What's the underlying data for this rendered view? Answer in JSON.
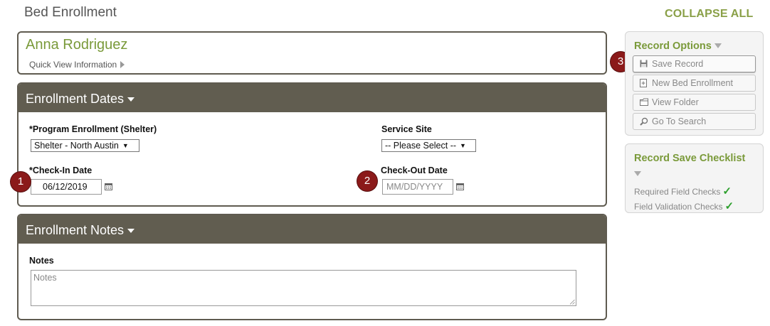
{
  "page": {
    "title": "Bed Enrollment",
    "collapse_all": "COLLAPSE ALL"
  },
  "client": {
    "name": "Anna Rodriguez",
    "quick_view": "Quick View Information"
  },
  "enrollment_dates": {
    "header": "Enrollment Dates",
    "program_label": "*Program Enrollment (Shelter)",
    "program_value": "Shelter - North Austin",
    "service_site_label": "Service Site",
    "service_site_value": "-- Please Select --",
    "checkin_label": "*Check-In Date",
    "checkin_value": "06/12/2019",
    "checkout_label": "Check-Out Date",
    "checkout_placeholder": "MM/DD/YYYY"
  },
  "enrollment_notes": {
    "header": "Enrollment Notes",
    "notes_label": "Notes",
    "notes_placeholder": "Notes"
  },
  "markers": [
    "1",
    "2",
    "3"
  ],
  "record_options": {
    "title": "Record Options",
    "buttons": [
      {
        "label": "Save Record",
        "icon": "floppy-disk-icon"
      },
      {
        "label": "New Bed Enrollment",
        "icon": "new-document-icon"
      },
      {
        "label": "View Folder",
        "icon": "folder-icon"
      },
      {
        "label": "Go To Search",
        "icon": "magnifier-icon"
      }
    ]
  },
  "checklist": {
    "title": "Record Save Checklist",
    "items": [
      "Required Field Checks",
      "Field Validation Checks"
    ]
  },
  "colors": {
    "accent_green": "#7a9a3a",
    "panel_header": "#615d50",
    "marker_red": "#8b1a1a",
    "check_green": "#2ea02e"
  }
}
